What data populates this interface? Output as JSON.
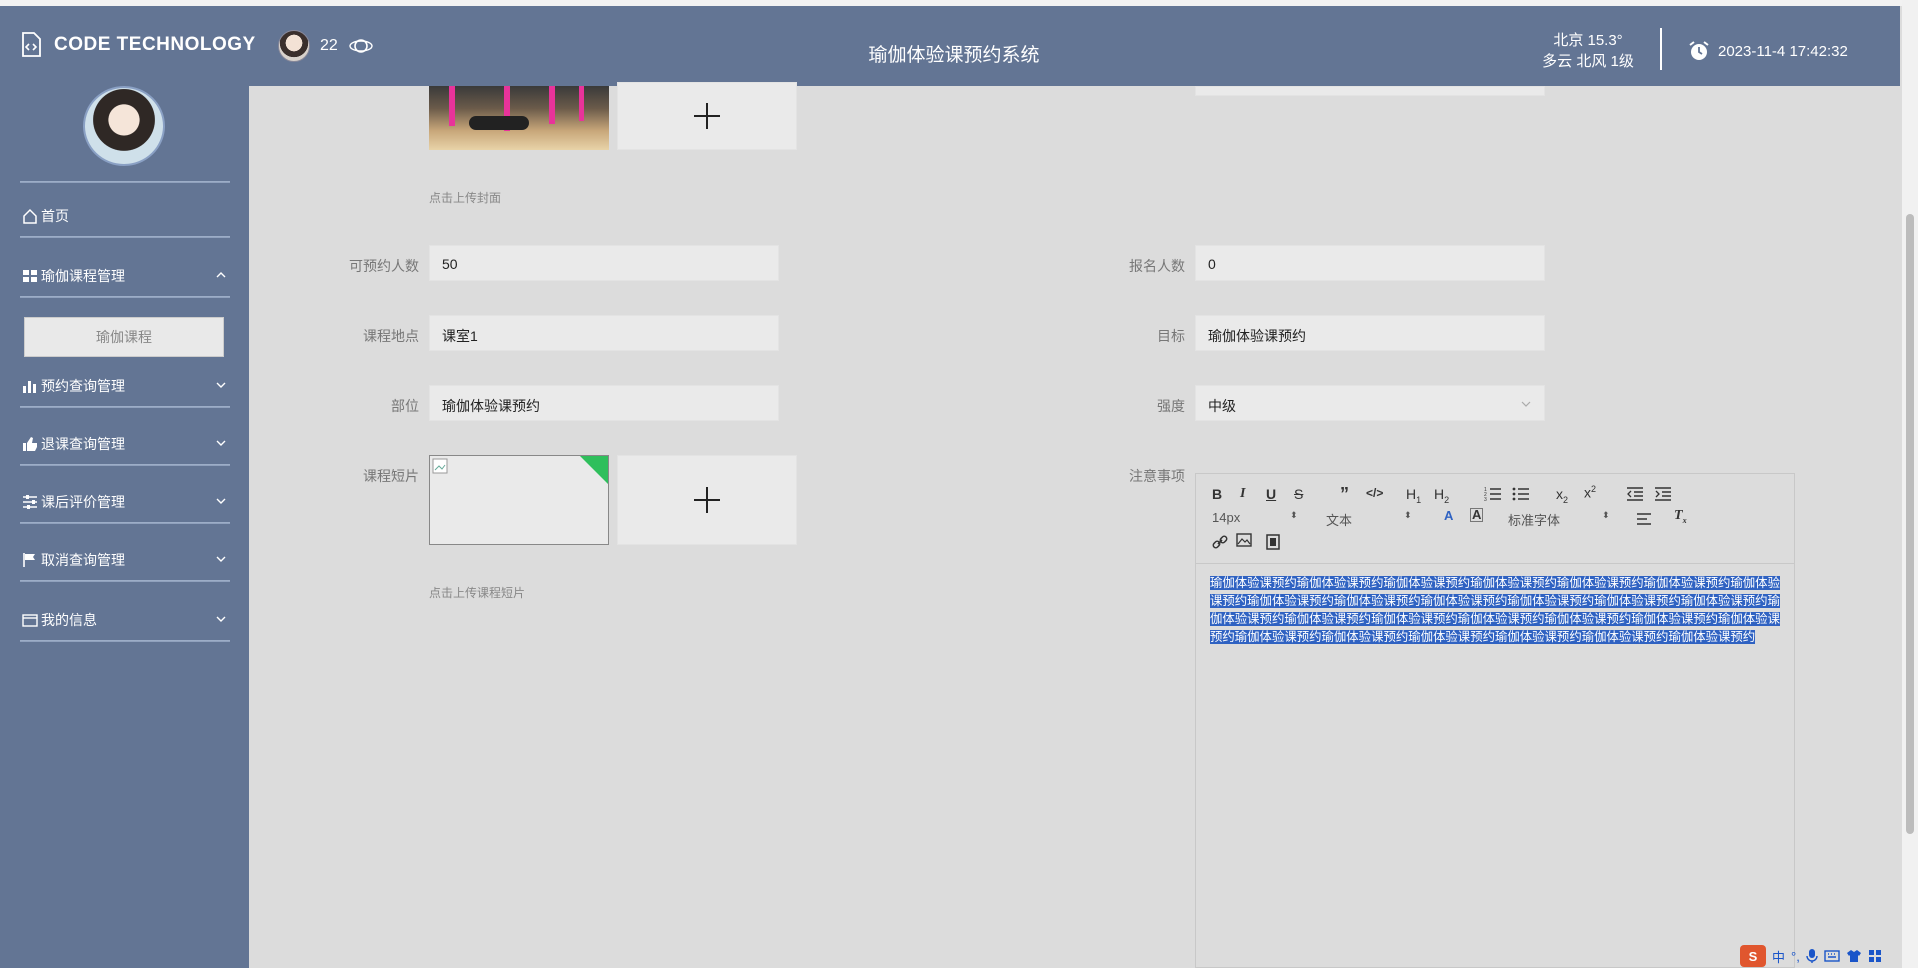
{
  "header": {
    "logo_text": "CODE TECHNOLOGY",
    "user_count": "22",
    "system_title": "瑜伽体验课预约系统",
    "weather_line1": "北京  15.3°",
    "weather_line2": "多云  北风  1级",
    "datetime": "2023-11-4 17:42:32"
  },
  "sidebar": {
    "home": "首页",
    "menus": [
      {
        "label": "瑜伽课程管理",
        "expanded": true
      },
      {
        "label": "预约查询管理",
        "expanded": false
      },
      {
        "label": "退课查询管理",
        "expanded": false
      },
      {
        "label": "课后评价管理",
        "expanded": false
      },
      {
        "label": "取消查询管理",
        "expanded": false
      },
      {
        "label": "我的信息",
        "expanded": false
      }
    ],
    "sub_item": "瑜伽课程"
  },
  "form": {
    "cover_tip": "点击上传封面",
    "capacity_label": "可预约人数",
    "capacity_value": "50",
    "enrolled_label": "报名人数",
    "enrolled_value": "0",
    "location_label": "课程地点",
    "location_value": "课室1",
    "goal_label": "目标",
    "goal_value": "瑜伽体验课预约",
    "part_label": "部位",
    "part_value": "瑜伽体验课预约",
    "intensity_label": "强度",
    "intensity_value": "中级",
    "video_label": "课程短片",
    "video_tip": "点击上传课程短片",
    "notes_label": "注意事项"
  },
  "editor": {
    "font_size": "14px",
    "block_type": "文本",
    "font_family": "标准字体",
    "content": "瑜伽体验课预约瑜伽体验课预约瑜伽体验课预约瑜伽体验课预约瑜伽体验课预约瑜伽体验课预约瑜伽体验课预约瑜伽体验课预约瑜伽体验课预约瑜伽体验课预约瑜伽体验课预约瑜伽体验课预约瑜伽体验课预约瑜伽体验课预约瑜伽体验课预约瑜伽体验课预约瑜伽体验课预约瑜伽体验课预约瑜伽体验课预约瑜伽体验课预约瑜伽体验课预约瑜伽体验课预约瑜伽体验课预约瑜伽体验课预约瑜伽体验课预约瑜伽体验课预约"
  },
  "taskbar": {
    "ime_label": "中"
  },
  "colors": {
    "header_bg": "#637594",
    "selection": "#2f62c2",
    "badge_green": "#2fbf5c"
  }
}
